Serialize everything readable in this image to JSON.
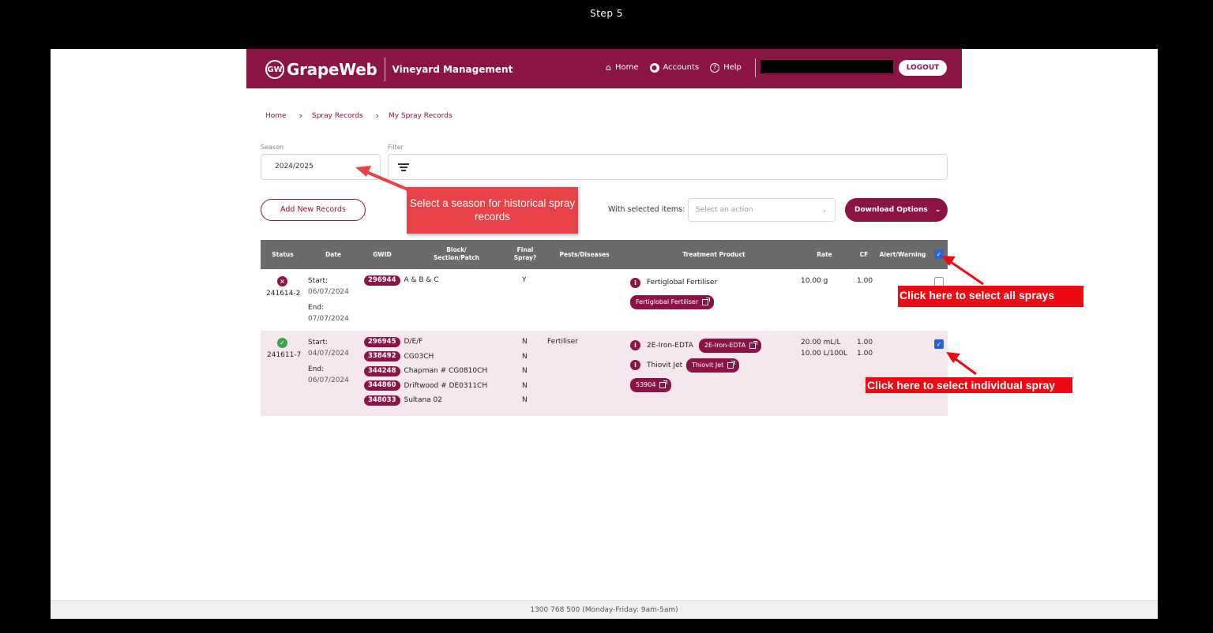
{
  "step_title": "Step 5",
  "header": {
    "logo_mark": "GW",
    "logo_text": "GrapeWeb",
    "subtitle": "Vineyard Management",
    "nav": [
      {
        "label": "Home",
        "icon": "home-icon"
      },
      {
        "label": "Accounts",
        "icon": "account-icon"
      },
      {
        "label": "Help",
        "icon": "help-icon"
      }
    ],
    "logout_label": "LOGOUT"
  },
  "breadcrumb": [
    "Home",
    "Spray Records",
    "My Spray Records"
  ],
  "filters": {
    "season_label": "Season",
    "season_value": "2024/2025",
    "filter_label": "Filter"
  },
  "actions": {
    "add_label": "Add New Records",
    "with_selected_label": "With selected items:",
    "action_placeholder": "Select an action",
    "download_label": "Download Options"
  },
  "table": {
    "headers": [
      "Status",
      "Date",
      "GWID",
      "Block/ Section/Patch",
      "Final Spray?",
      "Pests/Diseases",
      "Treatment Product",
      "Rate",
      "CF",
      "Alert/Warning"
    ],
    "rows": [
      {
        "status": "error",
        "id": "241614-2",
        "start_label": "Start:",
        "start": "06/07/2024",
        "end_label": "End:",
        "end": "07/07/2024",
        "blocks": [
          {
            "gwid": "296944",
            "name": "A & B & C",
            "final": "Y"
          }
        ],
        "pests": "",
        "products": [
          {
            "name": "Fertiglobal Fertiliser",
            "tag": "Fertiglobal Fertiliser"
          }
        ],
        "rates": [
          "10.00 g"
        ],
        "cf": [
          "1.00"
        ],
        "checked": false
      },
      {
        "status": "ok",
        "id": "241611-7",
        "start_label": "Start:",
        "start": "04/07/2024",
        "end_label": "End:",
        "end": "06/07/2024",
        "blocks": [
          {
            "gwid": "296945",
            "name": "D/E/F",
            "final": "N"
          },
          {
            "gwid": "338492",
            "name": "CG03CH",
            "final": "N"
          },
          {
            "gwid": "344248",
            "name": "Chapman # CG0810CH",
            "final": "N"
          },
          {
            "gwid": "344860",
            "name": "Driftwood # DE0311CH",
            "final": "N"
          },
          {
            "gwid": "348033",
            "name": "Sultana 02",
            "final": "N"
          }
        ],
        "pests": "Fertiliser",
        "products": [
          {
            "name": "2E-Iron-EDTA",
            "tag": "2E-Iron-EDTA"
          },
          {
            "name": "Thiovit Jet",
            "tag": "Thiovit Jet"
          }
        ],
        "extra_tag": "53904",
        "rates": [
          "20.00 mL/L",
          "10.00 L/100L"
        ],
        "cf": [
          "1.00",
          "1.00"
        ],
        "checked": true
      }
    ],
    "select_all_checked": true
  },
  "annotations": {
    "season_callout": "Select a season for historical spray records",
    "select_all_callout": "Click here to select all sprays",
    "select_individual_callout": "Click here to select individual spray"
  },
  "footer_text": "1300 768 500 (Monday-Friday: 9am-5am)",
  "colors": {
    "brand": "#8b1346",
    "callout": "#e94148",
    "checkbox": "#2a62d8",
    "table_header": "#6b6b6b",
    "row_highlight": "#f6e6ee"
  }
}
